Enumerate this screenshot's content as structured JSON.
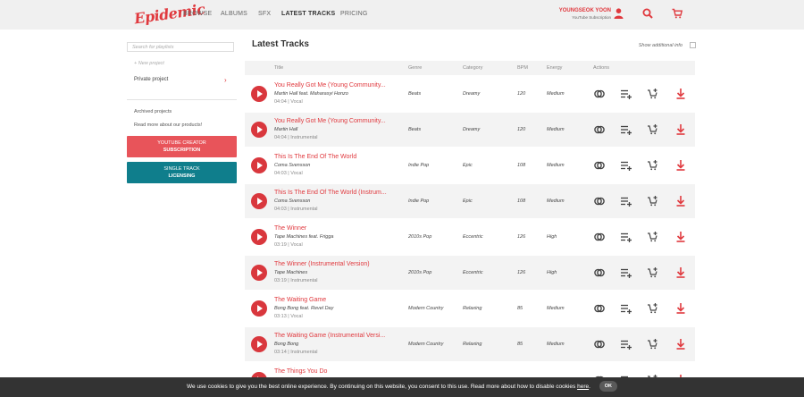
{
  "header": {
    "logo": "Epidemic",
    "nav": [
      "BROWSE",
      "ALBUMS",
      "SFX",
      "LATEST TRACKS",
      "PRICING"
    ],
    "active_nav": "LATEST TRACKS",
    "user_name": "YOUNGSEOK YOON",
    "user_subscription": "YouTube Subscription",
    "icons": [
      "user-icon",
      "search-icon",
      "cart-icon"
    ],
    "accent_color": "#e0393e"
  },
  "sidebar": {
    "search_placeholder": "Search for playlists",
    "new_project": "+ New project",
    "private_project": "Private project",
    "archived_projects": "Archived projects",
    "read_more": "Read more about our products!",
    "youtube_button": {
      "line1": "YOUTUBE CREATOR",
      "line2": "SUBSCRIPTION"
    },
    "single_track_button": {
      "line1": "SINGLE TRACK",
      "line2": "LICENSING"
    }
  },
  "main": {
    "title": "Latest Tracks",
    "show_additional_info": "Show additional info",
    "columns": [
      "Title",
      "Genre",
      "Category",
      "BPM",
      "Energy",
      "Actions"
    ],
    "tracks": [
      {
        "title": "You Really Got Me (Young Community...",
        "artist": "Martin Hall feat. Maharasyi Honzo",
        "meta": "04:04 | Vocal",
        "genre": "Beats",
        "category": "Dreamy",
        "bpm": "120",
        "energy": "Medium"
      },
      {
        "title": "You Really Got Me (Young Community...",
        "artist": "Martin Hall",
        "meta": "04:04 | Instrumental",
        "genre": "Beats",
        "category": "Dreamy",
        "bpm": "120",
        "energy": "Medium"
      },
      {
        "title": "This Is The End Of The World",
        "artist": "Coma Svensson",
        "meta": "04:03 | Vocal",
        "genre": "Indie Pop",
        "category": "Epic",
        "bpm": "108",
        "energy": "Medium"
      },
      {
        "title": "This Is The End Of The World (Instrum...",
        "artist": "Coma Svensson",
        "meta": "04:03 | Instrumental",
        "genre": "Indie Pop",
        "category": "Epic",
        "bpm": "108",
        "energy": "Medium"
      },
      {
        "title": "The Winner",
        "artist": "Tape Machines feat. Frigga",
        "meta": "03:19 | Vocal",
        "genre": "2010s Pop",
        "category": "Eccentric",
        "bpm": "126",
        "energy": "High"
      },
      {
        "title": "The Winner (Instrumental Version)",
        "artist": "Tape Machines",
        "meta": "03:19 | Instrumental",
        "genre": "2010s Pop",
        "category": "Eccentric",
        "bpm": "126",
        "energy": "High"
      },
      {
        "title": "The Waiting Game",
        "artist": "Bong Bong feat. Revel Day",
        "meta": "03:13 | Vocal",
        "genre": "Modern Country",
        "category": "Relaxing",
        "bpm": "85",
        "energy": "Medium"
      },
      {
        "title": "The Waiting Game (Instrumental Versi...",
        "artist": "Bong Bong",
        "meta": "03:14 | Instrumental",
        "genre": "Modern Country",
        "category": "Relaxing",
        "bpm": "85",
        "energy": "Medium"
      },
      {
        "title": "The Things You Do",
        "artist": "",
        "meta": "",
        "genre": "",
        "category": "",
        "bpm": "",
        "energy": ""
      }
    ],
    "row_actions": [
      "similar-icon",
      "add-to-playlist-icon",
      "add-to-cart-icon",
      "download-icon"
    ]
  },
  "cookie_banner": {
    "text": "We use cookies to give you the best online experience. By continuing on this website, you consent to this use. Read more about how to disable cookies",
    "link": "here",
    "period": ".",
    "ok": "OK"
  }
}
